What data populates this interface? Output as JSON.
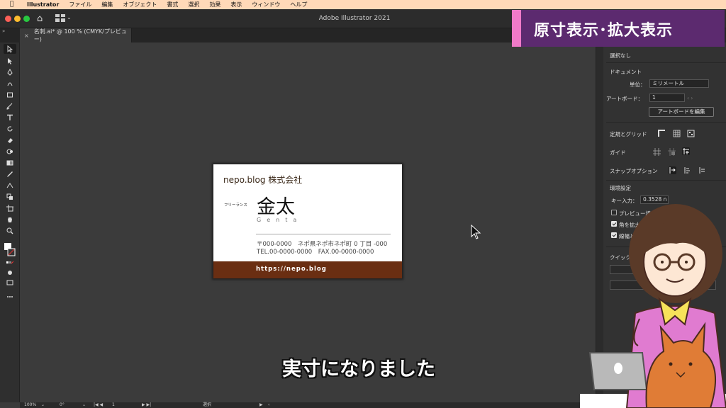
{
  "menubar": {
    "app": "Illustrator",
    "items": [
      "ファイル",
      "編集",
      "オブジェクト",
      "書式",
      "選択",
      "効果",
      "表示",
      "ウィンドウ",
      "ヘルプ"
    ]
  },
  "window": {
    "title": "Adobe Illustrator 2021",
    "tab_label": "名刺.ai* @ 100 % (CMYK/プレビュー)"
  },
  "artboard": {
    "company": "nepo.blog 株式会社",
    "role": "フリーランス",
    "name": "金太",
    "romaji": "Genta",
    "address": "〒000-0000　ネポ県ネポ市ネポ町 0 丁目 -000",
    "tel_fax": "TEL.00-0000-0000　FAX.00-0000-0000",
    "url": "https://nepo.blog",
    "footer_color": "#6a2e12"
  },
  "statusbar": {
    "zoom": "100%",
    "rotation": "0°",
    "artboard_index": "1",
    "selection_tool": "選択"
  },
  "panel": {
    "no_selection": "選択なし",
    "document_header": "ドキュメント",
    "unit_label": "単位：",
    "unit_value": "ミリメートル",
    "artboard_label": "アートボード：",
    "artboard_value": "1",
    "edit_artboard_button": "アートボードを編集",
    "rulers_grids": "定規とグリッド",
    "guides": "ガイド",
    "snap_options": "スナップオプション",
    "preferences": "環境設定",
    "key_increment_label": "キー入力：",
    "key_increment_value": "0.3528 n",
    "preview_bounds": "プレビュー境界",
    "scale_corners": "角を拡大・縮小",
    "scale_strokes": "線幅と効果も拡大・縮小",
    "quick_actions": "クイック操作"
  },
  "overlay": {
    "banner": "原寸表示･拡大表示",
    "subtitle": "実寸になりました",
    "banner_color": "#5c2a6f",
    "banner_accent": "#f07ac8"
  }
}
